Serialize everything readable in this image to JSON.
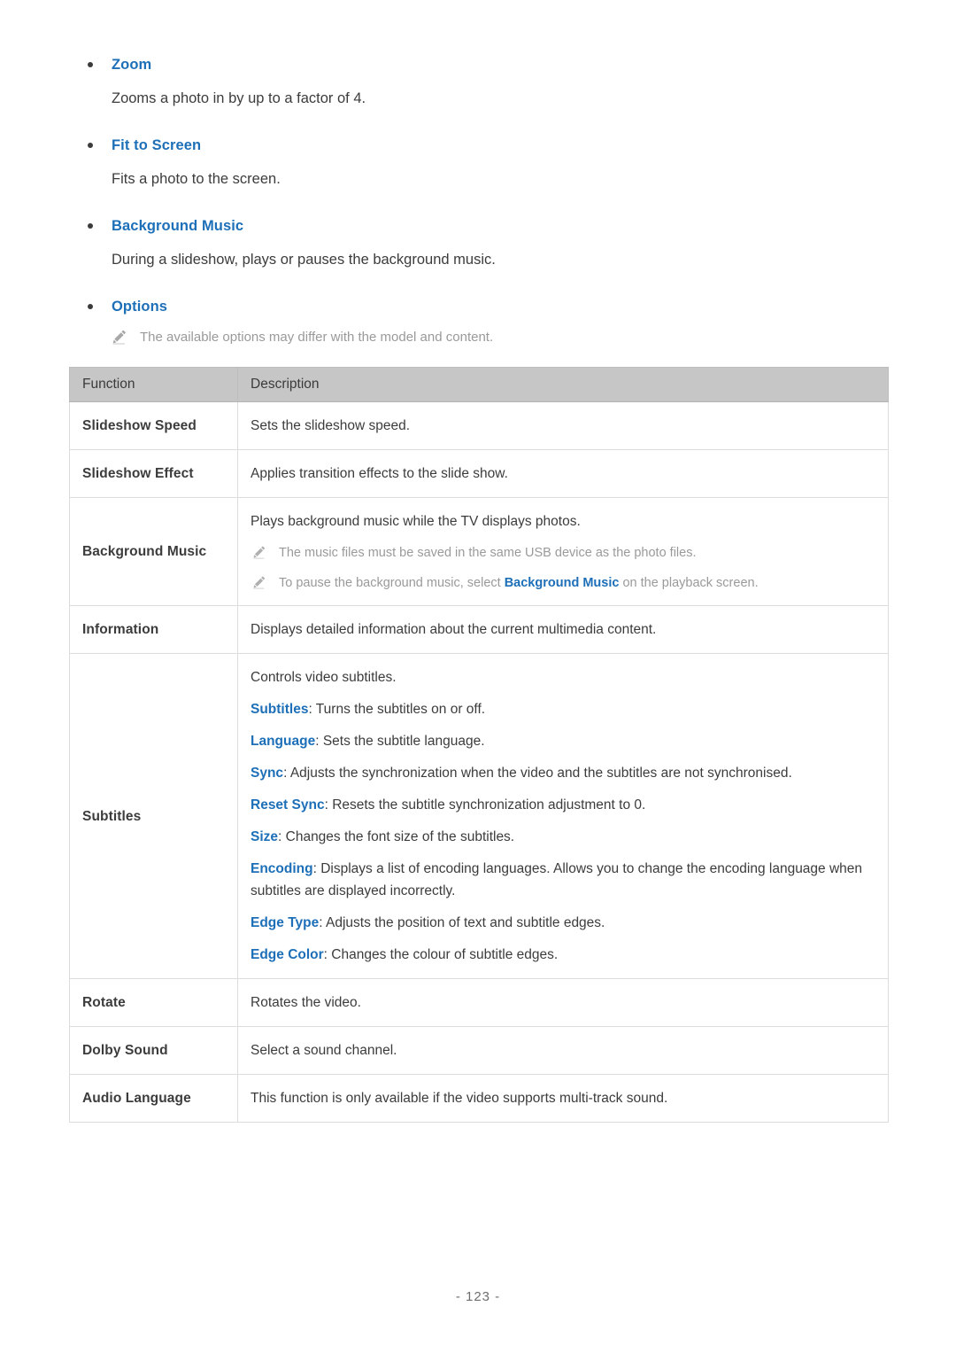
{
  "bullets": [
    {
      "title": "Zoom",
      "body": "Zooms a photo in by up to a factor of 4."
    },
    {
      "title": "Fit to Screen",
      "body": "Fits a photo to the screen."
    },
    {
      "title": "Background Music",
      "body": "During a slideshow, plays or pauses the background music."
    },
    {
      "title": "Options",
      "body": ""
    }
  ],
  "options_note": {
    "icon": "pencil-icon",
    "text": "The available options may differ with the model and content."
  },
  "table": {
    "headers": {
      "function": "Function",
      "description": "Description"
    },
    "rows": [
      {
        "function": "Slideshow Speed",
        "lines": [
          {
            "type": "text",
            "text": "Sets the slideshow speed."
          }
        ]
      },
      {
        "function": "Slideshow Effect",
        "lines": [
          {
            "type": "text",
            "text": "Applies transition effects to the slide show."
          }
        ]
      },
      {
        "function": "Background Music",
        "lines": [
          {
            "type": "text",
            "text": "Plays background music while the TV displays photos."
          },
          {
            "type": "note",
            "text": "The music files must be saved in the same USB device as the photo files."
          },
          {
            "type": "note",
            "pre": "To pause the background music, select ",
            "keyword": "Background Music",
            "post": " on the playback screen."
          }
        ]
      },
      {
        "function": "Information",
        "lines": [
          {
            "type": "text",
            "text": "Displays detailed information about the current multimedia content."
          }
        ]
      },
      {
        "function": "Subtitles",
        "lines": [
          {
            "type": "text",
            "text": "Controls video subtitles."
          },
          {
            "type": "kw",
            "keyword": "Subtitles",
            "text": ": Turns the subtitles on or off."
          },
          {
            "type": "kw",
            "keyword": "Language",
            "text": ": Sets the subtitle language."
          },
          {
            "type": "kw",
            "keyword": "Sync",
            "text": ": Adjusts the synchronization when the video and the subtitles are not synchronised."
          },
          {
            "type": "kw",
            "keyword": "Reset Sync",
            "text": ": Resets the subtitle synchronization adjustment to 0."
          },
          {
            "type": "kw",
            "keyword": "Size",
            "text": ": Changes the font size of the subtitles."
          },
          {
            "type": "kw",
            "keyword": "Encoding",
            "text": ": Displays a list of encoding languages. Allows you to change the encoding language when subtitles are displayed incorrectly."
          },
          {
            "type": "kw",
            "keyword": "Edge Type",
            "text": ": Adjusts the position of text and subtitle edges."
          },
          {
            "type": "kw",
            "keyword": "Edge Color",
            "text": ": Changes the colour of subtitle edges."
          }
        ]
      },
      {
        "function": "Rotate",
        "lines": [
          {
            "type": "text",
            "text": "Rotates the video."
          }
        ]
      },
      {
        "function": "Dolby Sound",
        "lines": [
          {
            "type": "text",
            "text": "Select a sound channel."
          }
        ]
      },
      {
        "function": "Audio Language",
        "lines": [
          {
            "type": "text",
            "text": "This function is only available if the video supports multi-track sound."
          }
        ]
      }
    ]
  },
  "footer": {
    "page_number": "- 123 -"
  },
  "colors": {
    "link_blue": "#1d6fb8",
    "body_text": "#3c3c3c",
    "note_gray": "#9a9a9a",
    "table_header_bg": "#c6c6c6",
    "table_border": "#dcdcdc"
  }
}
